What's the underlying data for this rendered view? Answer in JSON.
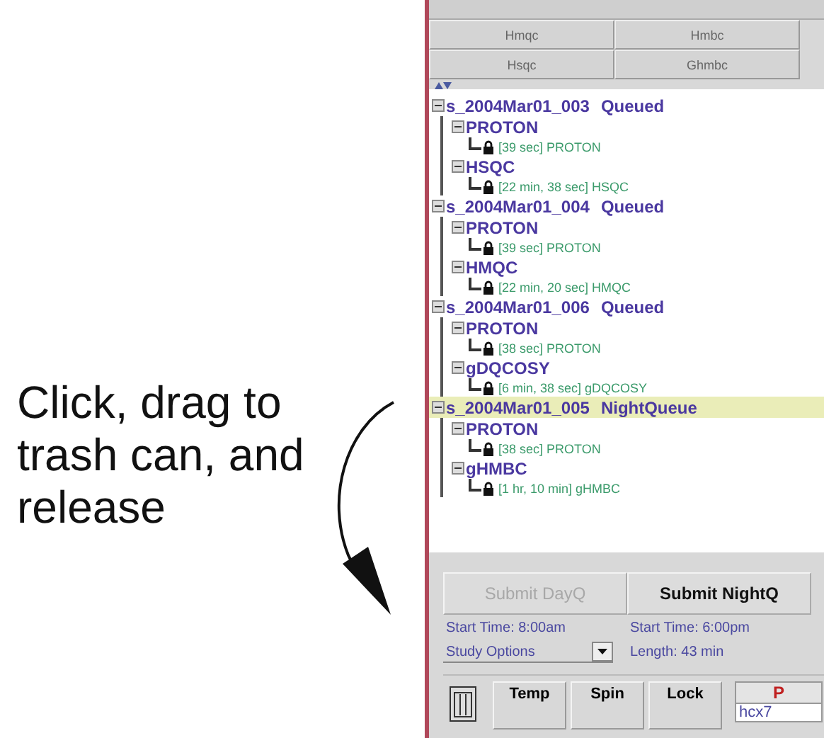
{
  "annotation": {
    "text": "Click, drag to trash can, and release"
  },
  "tabs": [
    {
      "label": "Hmqc",
      "selected": false
    },
    {
      "label": "Hmbc",
      "selected": false
    },
    {
      "label": "Hsqc",
      "selected": false
    },
    {
      "label": "Ghmbc",
      "selected": false
    }
  ],
  "queue": [
    {
      "label": "s_2004Mar01_003",
      "status": "Queued",
      "expanded": true,
      "selected": false,
      "children": [
        {
          "label": "PROTON",
          "expanded": true,
          "children": [
            {
              "text": "[39 sec] PROTON",
              "locked": true
            }
          ]
        },
        {
          "label": "HSQC",
          "expanded": true,
          "children": [
            {
              "text": "[22 min, 38 sec] HSQC",
              "locked": true
            }
          ]
        }
      ]
    },
    {
      "label": "s_2004Mar01_004",
      "status": "Queued",
      "expanded": true,
      "selected": false,
      "children": [
        {
          "label": "PROTON",
          "expanded": true,
          "children": [
            {
              "text": "[39 sec] PROTON",
              "locked": true
            }
          ]
        },
        {
          "label": "HMQC",
          "expanded": true,
          "children": [
            {
              "text": "[22 min, 20 sec] HMQC",
              "locked": true
            }
          ]
        }
      ]
    },
    {
      "label": "s_2004Mar01_006",
      "status": "Queued",
      "expanded": true,
      "selected": false,
      "children": [
        {
          "label": "PROTON",
          "expanded": true,
          "children": [
            {
              "text": "[38 sec] PROTON",
              "locked": true
            }
          ]
        },
        {
          "label": "gDQCOSY",
          "expanded": true,
          "children": [
            {
              "text": "[6 min, 38 sec] gDQCOSY",
              "locked": true
            }
          ]
        }
      ]
    },
    {
      "label": "s_2004Mar01_005",
      "status": "NightQueue",
      "expanded": true,
      "selected": true,
      "children": [
        {
          "label": "PROTON",
          "expanded": true,
          "children": [
            {
              "text": "[38 sec] PROTON",
              "locked": true
            }
          ]
        },
        {
          "label": "gHMBC",
          "expanded": true,
          "children": [
            {
              "text": "[1 hr, 10 min] gHMBC",
              "locked": true
            }
          ]
        }
      ]
    }
  ],
  "submit_buttons": [
    {
      "label": "Submit DayQ",
      "disabled": true
    },
    {
      "label": "Submit NightQ",
      "disabled": false
    }
  ],
  "day_start": "Start Time: 8:00am",
  "night_start": "Start Time: 6:00pm",
  "study_options": {
    "value": "Study Options"
  },
  "length": "Length: 43 min",
  "toolbar": [
    "Temp",
    "Spin",
    "Lock"
  ],
  "status_box": {
    "title": "P",
    "text": "hcx7"
  }
}
